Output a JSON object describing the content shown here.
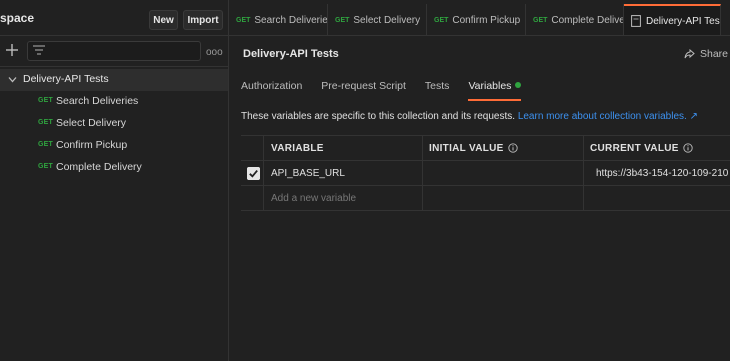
{
  "workspace": {
    "name": "space",
    "new_label": "New",
    "import_label": "Import"
  },
  "sidebar": {
    "more_label": "ooo",
    "collection": {
      "name": "Delivery-API Tests",
      "requests": [
        {
          "method": "GET",
          "name": "Search Deliveries"
        },
        {
          "method": "GET",
          "name": "Select Delivery"
        },
        {
          "method": "GET",
          "name": "Confirm Pickup"
        },
        {
          "method": "GET",
          "name": "Complete Delivery"
        }
      ]
    }
  },
  "tabs": [
    {
      "method": "GET",
      "label": "Search Deliverie"
    },
    {
      "method": "GET",
      "label": "Select Delivery"
    },
    {
      "method": "GET",
      "label": "Confirm Pickup"
    },
    {
      "method": "GET",
      "label": "Complete Delive"
    },
    {
      "method": "",
      "label": "Delivery-API Tes"
    }
  ],
  "main": {
    "title": "Delivery-API Tests",
    "share_label": "Share",
    "subtabs": [
      "Authorization",
      "Pre-request Script",
      "Tests",
      "Variables"
    ],
    "description": "These variables are specific to this collection and its requests.",
    "learn_more": "Learn more about collection variables. ↗"
  },
  "variables": {
    "headers": [
      "VARIABLE",
      "INITIAL VALUE",
      "CURRENT VALUE"
    ],
    "rows": [
      {
        "checked": true,
        "variable": "API_BASE_URL",
        "initial": "",
        "current": "https://3b43-154-120-109-210"
      }
    ],
    "add_placeholder": "Add a new variable"
  },
  "colors": {
    "accent": "#ff6c37",
    "get_method": "#2fa33f",
    "link": "#3d91ef",
    "background": "#212121"
  }
}
